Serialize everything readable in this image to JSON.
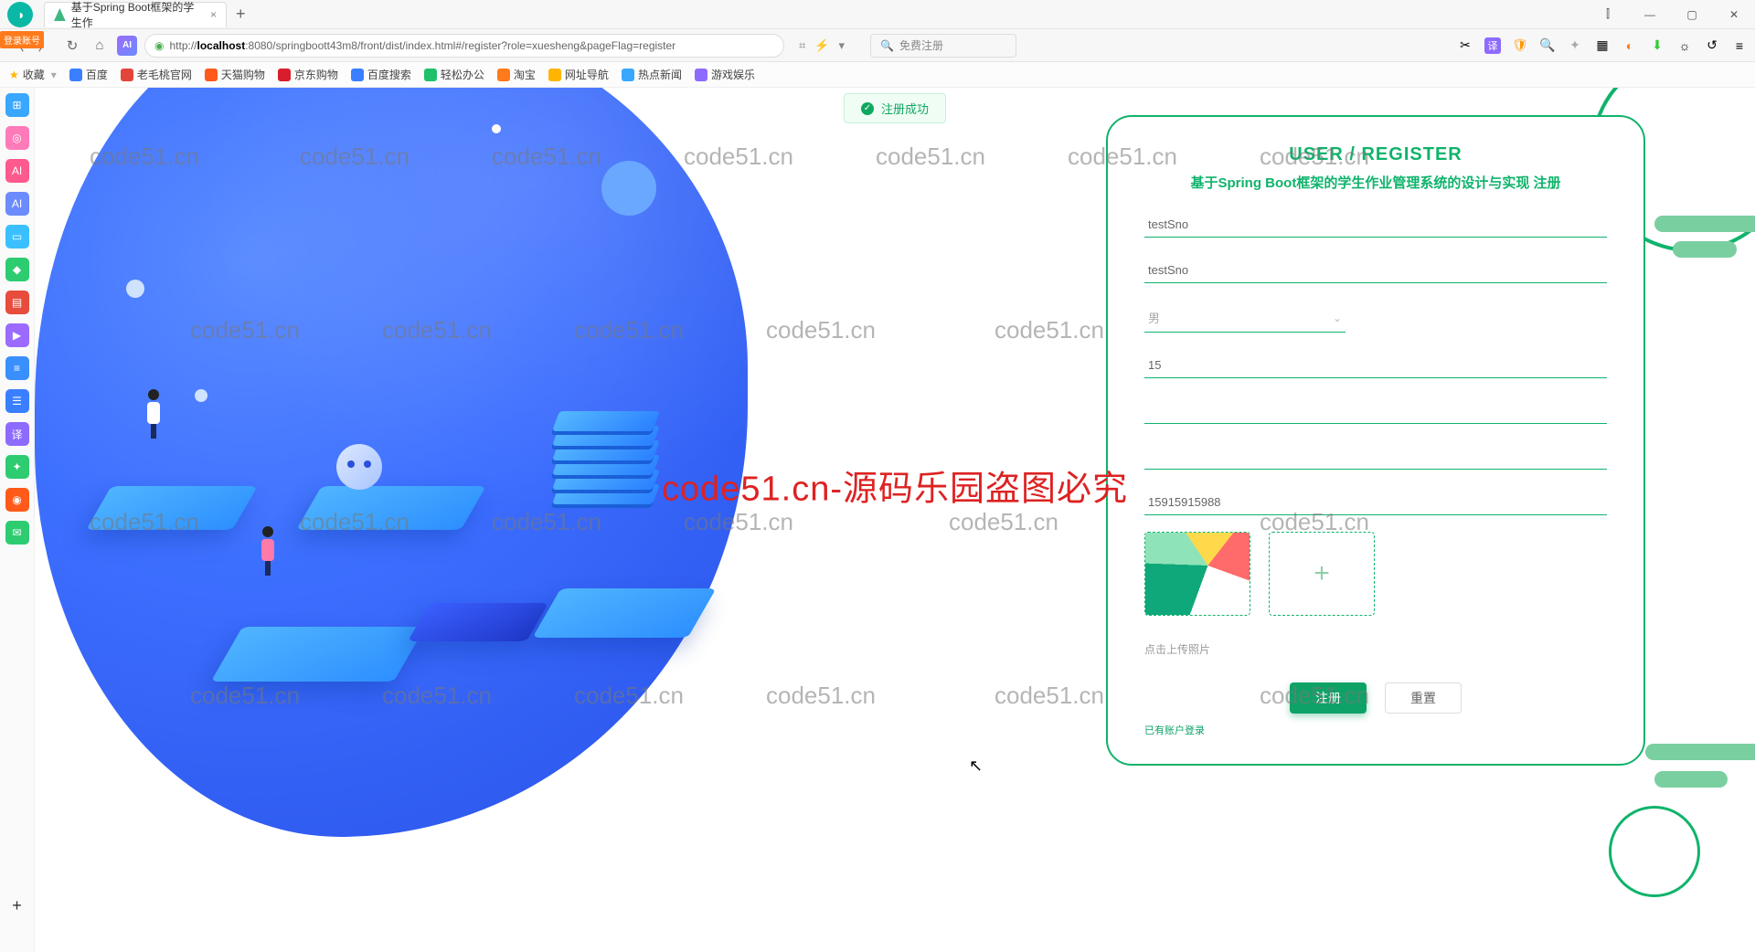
{
  "browser": {
    "tab_title": "基于Spring Boot框架的学生作",
    "url_prefix": "http://",
    "url_host": "localhost",
    "url_rest": ":8080/springboott43m8/front/dist/index.html#/register?role=xuesheng&pageFlag=register",
    "login_tag": "登录账号",
    "search_placeholder": "免费注册",
    "fav_label": "收藏"
  },
  "bookmarks": [
    "百度",
    "老毛桃官网",
    "天猫购物",
    "京东购物",
    "百度搜索",
    "轻松办公",
    "淘宝",
    "网址导航",
    "热点新闻",
    "游戏娱乐"
  ],
  "toast": {
    "text": "注册成功"
  },
  "card": {
    "title": "USER / REGISTER",
    "subtitle": "基于Spring Boot框架的学生作业管理系统的设计与实现 注册",
    "f1": "testSno",
    "f2": "testSno",
    "gender": "男",
    "age": "15",
    "f5": "",
    "f6": "",
    "phone": "15915915988",
    "upload_hint": "点击上传照片",
    "btn_register": "注册",
    "btn_reset": "重置",
    "login_link": "已有账户登录"
  },
  "watermark": {
    "small": "code51.cn",
    "big": "code51.cn-源码乐园盗图必究"
  }
}
